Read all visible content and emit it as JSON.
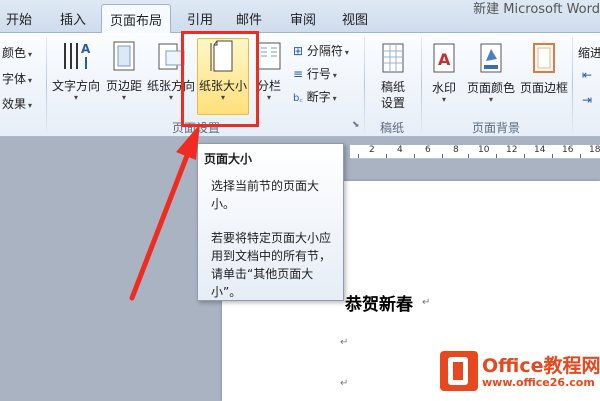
{
  "window": {
    "title": "新建 Microsoft Word"
  },
  "tabs": [
    {
      "label": "开始"
    },
    {
      "label": "插入"
    },
    {
      "label": "页面布局",
      "active": true
    },
    {
      "label": "引用"
    },
    {
      "label": "邮件"
    },
    {
      "label": "审阅"
    },
    {
      "label": "视图"
    }
  ],
  "ribbon": {
    "theme": {
      "colors": "颜色",
      "fonts": "字体",
      "effects": "效果"
    },
    "page_setup": {
      "text_direction": "文字方向",
      "margins": "页边距",
      "orientation": "纸张方向",
      "size": "纸张大小",
      "columns": "分栏",
      "breaks": "分隔符",
      "line_numbers": "行号",
      "hyphenation": "断字",
      "group_label": "页面设置"
    },
    "draft": {
      "setup": "稿纸\n设置",
      "group_label": "稿纸"
    },
    "background": {
      "watermark": "水印",
      "page_color": "页面颜色",
      "page_borders": "页面边框",
      "group_label": "页面背景"
    },
    "paragraph": {
      "indent": "缩进"
    }
  },
  "ruler": {
    "numbers": [
      "2",
      "4",
      "6",
      "8",
      "10",
      "12",
      "14",
      "16",
      "18"
    ]
  },
  "tooltip": {
    "title": "页面大小",
    "description": "选择当前节的页面大小。",
    "detail": "若要将特定页面大小应用到文档中的所有节，请单击“其他页面大小”。"
  },
  "document": {
    "heading": "恭贺新春",
    "paragraph_mark": "↵"
  },
  "watermark": {
    "name": "Office教程网",
    "url": "www.office26.com"
  },
  "colors": {
    "accent_red": "#ee2c22",
    "highlight": "#ffe07a",
    "brand": "#e8481f"
  }
}
